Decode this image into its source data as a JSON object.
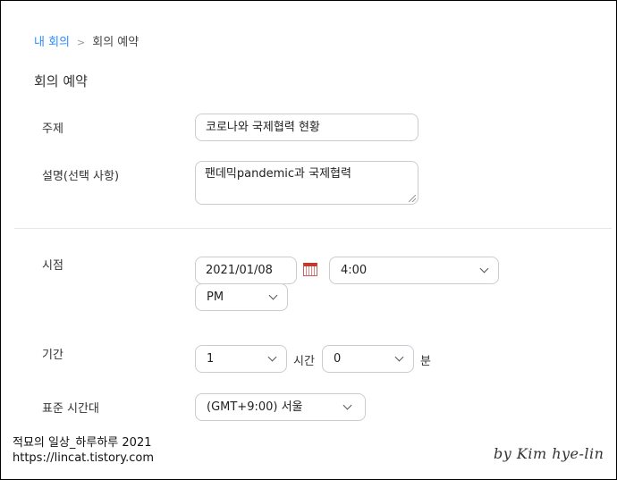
{
  "breadcrumb": {
    "parent": "내 회의",
    "separator": ">",
    "current": "회의 예약"
  },
  "page": {
    "title": "회의 예약"
  },
  "form": {
    "topic": {
      "label": "주제",
      "value": "코로나와 국제협력 현황"
    },
    "description": {
      "label": "설명(선택 사항)",
      "value": "팬데믹pandemic과 국제협력"
    },
    "when": {
      "label": "시점",
      "date": "2021/01/08",
      "time": "4:00",
      "ampm": "PM"
    },
    "duration": {
      "label": "기간",
      "hours": "1",
      "hours_unit": "시간",
      "minutes": "0",
      "minutes_unit": "분"
    },
    "timezone": {
      "label": "표준 시간대",
      "value": "(GMT+9:00) 서울"
    }
  },
  "watermark": {
    "line1": "적묘의 일상_하루하루 2021",
    "line2": "https://lincat.tistory.com",
    "author": "by Kim hye-lin"
  },
  "colors": {
    "link": "#2d8cff",
    "border": "#c9ccd1"
  }
}
